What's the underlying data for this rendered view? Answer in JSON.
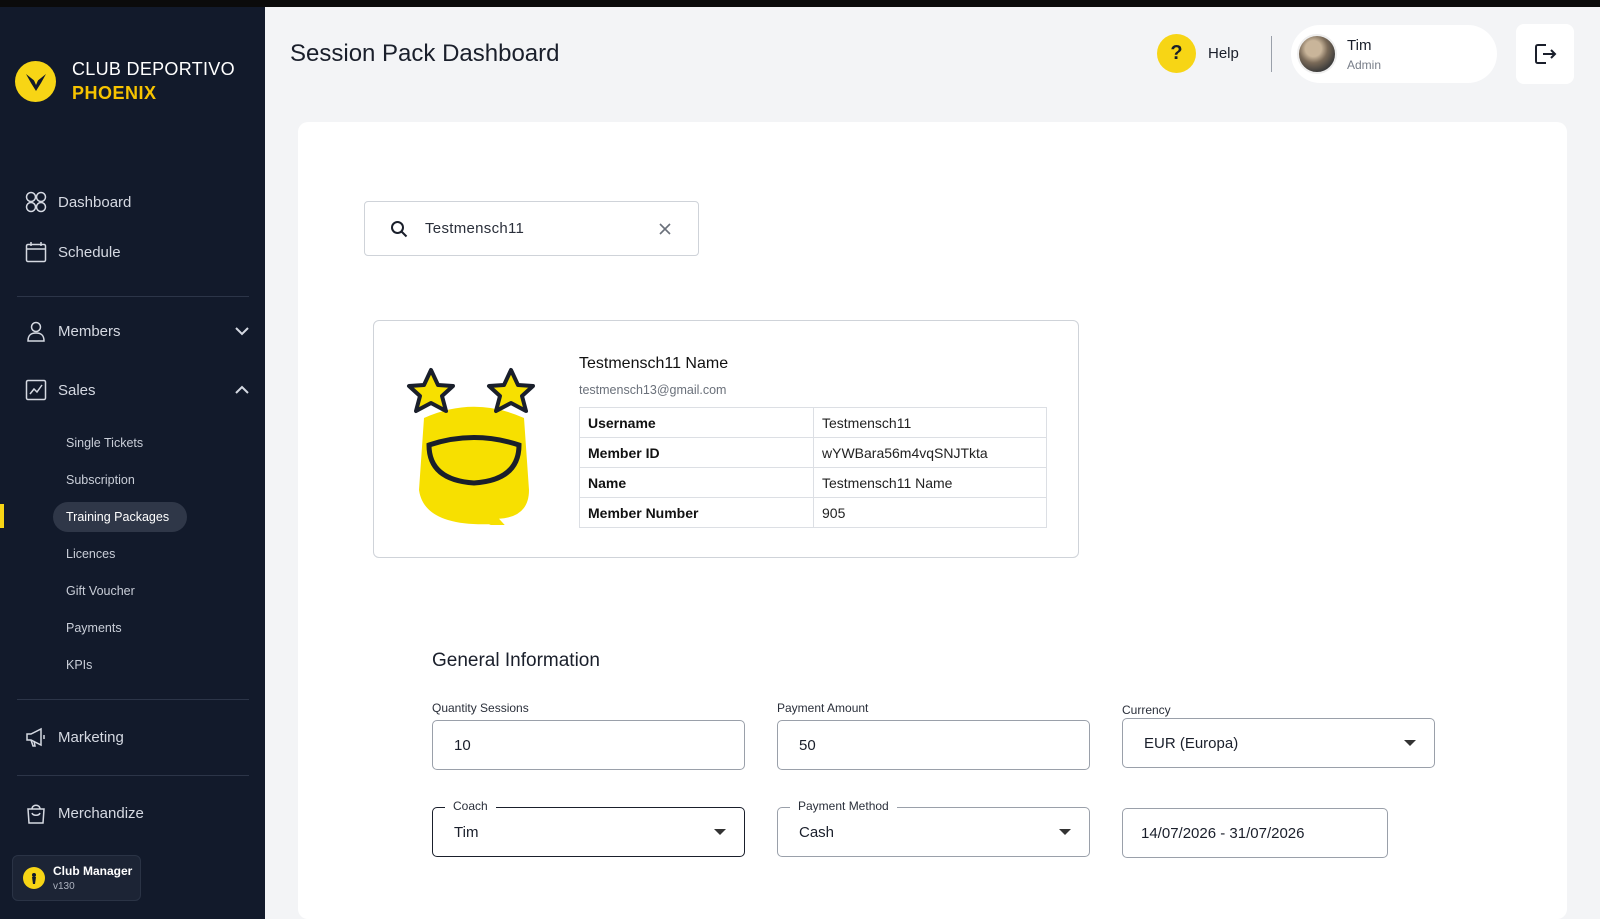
{
  "brand": {
    "line1": "CLUB DEPORTIVO",
    "line2": "PHOENIX"
  },
  "nav": {
    "dashboard": "Dashboard",
    "schedule": "Schedule",
    "members": "Members",
    "sales": "Sales",
    "marketing": "Marketing",
    "merchandize": "Merchandize"
  },
  "sales_items": [
    "Single Tickets",
    "Subscription",
    "Training Packages",
    "Licences",
    "Gift Voucher",
    "Payments",
    "KPIs"
  ],
  "footer": {
    "title": "Club Manager",
    "version": "v130"
  },
  "header": {
    "title": "Session Pack Dashboard",
    "help": "Help",
    "user_name": "Tim",
    "user_role": "Admin"
  },
  "search": {
    "value": "Testmensch11"
  },
  "member": {
    "name": "Testmensch11 Name",
    "email": "testmensch13@gmail.com",
    "rows": [
      {
        "key": "Username",
        "value": "Testmensch11"
      },
      {
        "key": "Member ID",
        "value": "wYWBara56m4vqSNJTkta"
      },
      {
        "key": "Name",
        "value": "Testmensch11 Name"
      },
      {
        "key": "Member Number",
        "value": "905"
      }
    ]
  },
  "general": {
    "title": "General Information",
    "quantity_label": "Quantity Sessions",
    "quantity_value": "10",
    "amount_label": "Payment Amount",
    "amount_value": "50",
    "currency_label": "Currency",
    "currency_value": "EUR (Europa)",
    "coach_label": "Coach",
    "coach_value": "Tim",
    "method_label": "Payment Method",
    "method_value": "Cash",
    "date_range": "14/07/2026 - 31/07/2026"
  },
  "colors": {
    "sidebar": "#121a2b",
    "accent": "#f7d515",
    "brand_accent": "#f7c400"
  }
}
